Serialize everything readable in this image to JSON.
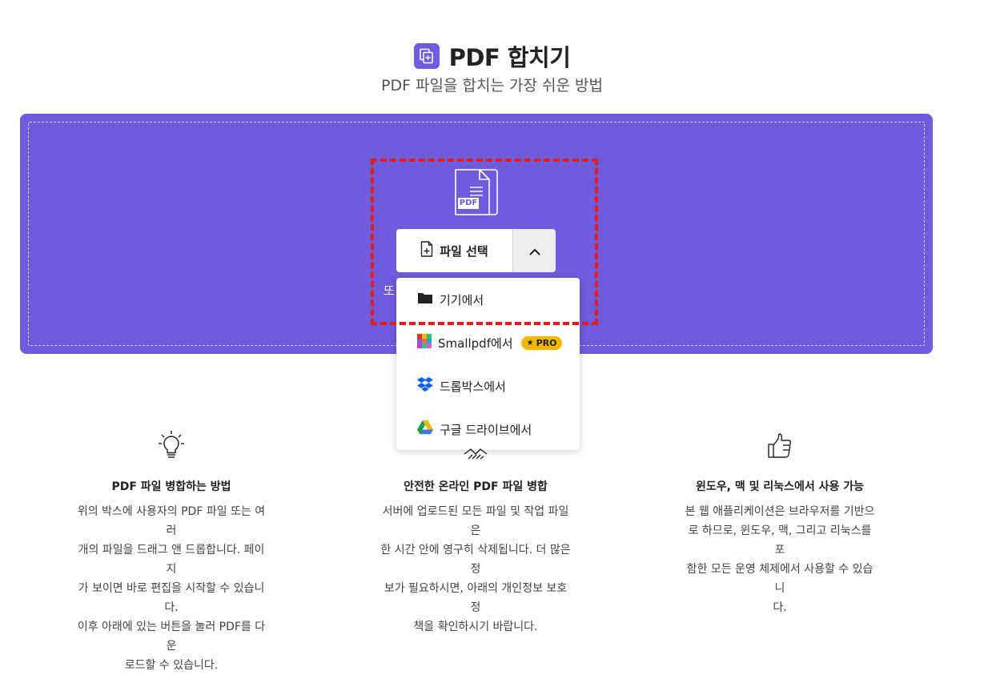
{
  "header": {
    "title": "PDF 합치기",
    "subtitle": "PDF 파일을 합치는 가장 쉬운 방법",
    "icon": "merge-pdf-icon"
  },
  "colors": {
    "accent": "#6f5bdd",
    "highlight": "#e51c1c",
    "pro_badge": "#f5b800"
  },
  "drop_zone": {
    "pdf_label": "PDF",
    "file_button_label": "파일 선택",
    "or_text": "또"
  },
  "dropdown": {
    "items": [
      {
        "label": "기기에서",
        "icon": "folder-icon"
      },
      {
        "label": "Smallpdf에서",
        "icon": "smallpdf-icon",
        "badge": "PRO"
      },
      {
        "label": "드롭박스에서",
        "icon": "dropbox-icon"
      },
      {
        "label": "구글 드라이브에서",
        "icon": "google-drive-icon"
      }
    ]
  },
  "features": [
    {
      "icon": "lightbulb-icon",
      "title": "PDF 파일 병합하는 방법",
      "lines": [
        "위의 박스에 사용자의 PDF 파일 또는 여러",
        "개의 파일을 드래그 앤 드롭합니다. 페이지",
        "가 보이면 바로 편집을 시작할 수 있습니다.",
        "이후 아래에 있는 버튼을 눌러 PDF를 다운",
        "로드할 수 있습니다."
      ]
    },
    {
      "icon": "handshake-icon",
      "title": "안전한 온라인 PDF 파일 병합",
      "lines": [
        "서버에 업로드된 모든 파일 및 작업 파일은",
        "한 시간 안에 영구히 삭제됩니다. 더 많은 정",
        "보가 필요하시면, 아래의 개인정보 보호정",
        "책을 확인하시기 바랍니다."
      ]
    },
    {
      "icon": "thumbs-up-icon",
      "title": "윈도우, 맥 및 리눅스에서 사용 가능",
      "lines": [
        "본 웹 애플리케이션은 브라우저를 기반으",
        "로 하므로, 윈도우, 맥, 그리고 리눅스를 포",
        "함한 모든 운영 체제에서 사용할 수 있습니",
        "다."
      ]
    }
  ]
}
